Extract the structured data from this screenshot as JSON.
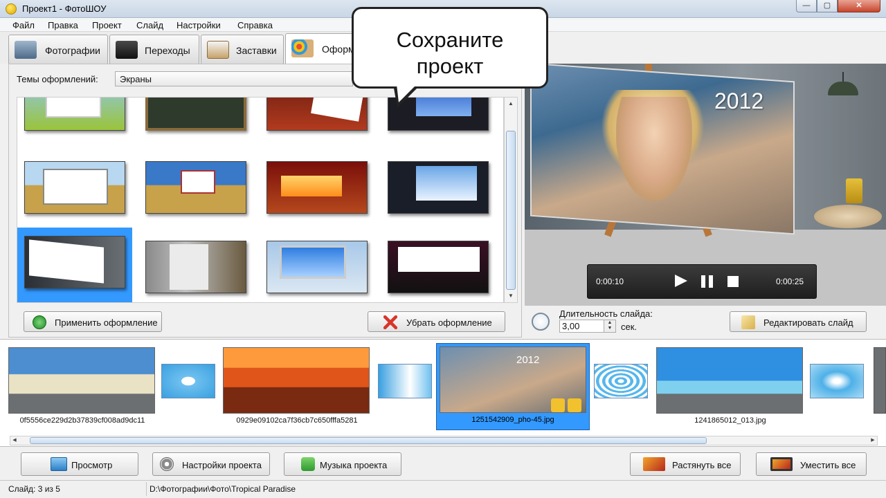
{
  "window": {
    "title": "Проект1 - ФотоШОУ",
    "close_glyph": "✕",
    "max_glyph": "▢",
    "min_glyph": "—"
  },
  "menu": [
    "Файл",
    "Правка",
    "Проект",
    "Слайд",
    "Настройки",
    "Справка"
  ],
  "tabs": [
    {
      "label": "Фотографии",
      "icon": "camera-icon"
    },
    {
      "label": "Переходы",
      "icon": "magic-hat-icon"
    },
    {
      "label": "Заставки",
      "icon": "easel-icon"
    },
    {
      "label": "Оформ",
      "icon": "palette-icon",
      "active": true
    }
  ],
  "callout": {
    "line1": "Сохраните",
    "line2": "проект"
  },
  "themes": {
    "label": "Темы оформлений:",
    "selected": "Экраны"
  },
  "theme_buttons": {
    "apply": "Применить оформление",
    "remove": "Убрать оформление"
  },
  "preview": {
    "year": "2012",
    "time_current": "0:00:10",
    "time_total": "0:00:25"
  },
  "slide_settings": {
    "duration_label": "Длительность слайда:",
    "duration_value": "3,00",
    "unit": "сек.",
    "edit_button": "Редактировать слайд"
  },
  "filmstrip": {
    "slides": [
      {
        "name": "0f5556ce229d2b37839cf008ad9dc11"
      },
      {
        "name": "0929e09102ca7f36cb7c650fffa5281"
      },
      {
        "name": "1251542909_pho-45.jpg",
        "selected": true
      },
      {
        "name": "1241865012_013.jpg"
      }
    ]
  },
  "bottom_buttons": {
    "preview": "Просмотр",
    "project_settings": "Настройки проекта",
    "project_music": "Музыка проекта",
    "stretch_all": "Растянуть все",
    "fit_all": "Уместить все"
  },
  "status": {
    "slide": "Слайд: 3 из 5",
    "path": "D:\\Фотографии\\Фото\\Tropical Paradise"
  },
  "colors": {
    "selection": "#3399ff",
    "accent_green": "#2e9a2e",
    "accent_red": "#d9342a"
  }
}
